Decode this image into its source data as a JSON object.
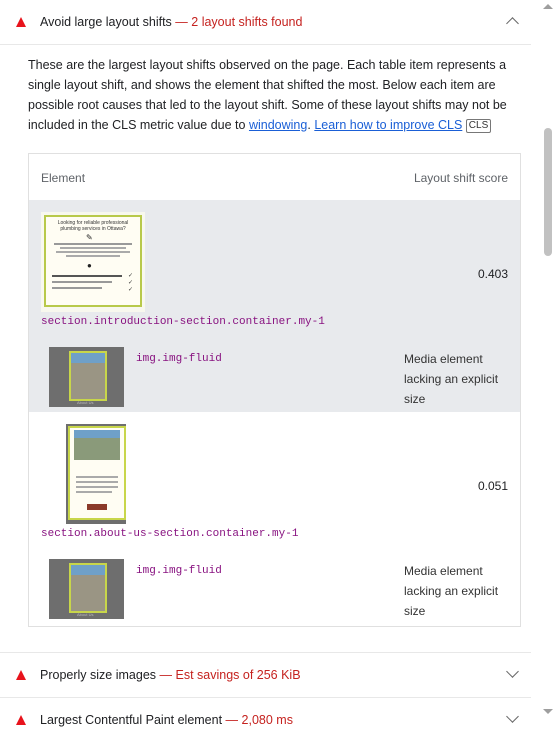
{
  "audit": {
    "title": "Avoid large layout shifts",
    "separator": "—",
    "summary": "2 layout shifts found",
    "description_text": "These are the largest layout shifts observed on the page. Each table item represents a single layout shift, and shows the element that shifted the most. Below each item are possible root causes that led to the layout shift. Some of these layout shifts may not be included in the CLS metric value due to ",
    "windowing_link": "windowing",
    "period": ".",
    "learn_link": "Learn how to improve CLS",
    "badge": "CLS"
  },
  "table": {
    "col_element": "Element",
    "col_score": "Layout shift score",
    "items": [
      {
        "selector": "section.introduction-section.container.my-1",
        "score": "0.403",
        "cause_selector": "img.img-fluid",
        "cause_reason": "Media element lacking an explicit size"
      },
      {
        "selector": "section.about-us-section.container.my-1",
        "score": "0.051",
        "cause_selector": "img.img-fluid",
        "cause_reason": "Media element lacking an explicit size"
      }
    ]
  },
  "next_audits": [
    {
      "title": "Properly size images",
      "separator": "—",
      "summary": "Est savings of 256 KiB"
    },
    {
      "title": "Largest Contentful Paint element",
      "separator": "—",
      "summary": "2,080 ms"
    }
  ],
  "thumbnail_text": {
    "intro_heading": "Looking for reliable professional plumbing services in Ottawa?",
    "caption": "About Us"
  },
  "colors": {
    "warn": "#e8131c",
    "accent_red": "#c5221f",
    "link": "#1a5fd6",
    "node": "#881280"
  }
}
